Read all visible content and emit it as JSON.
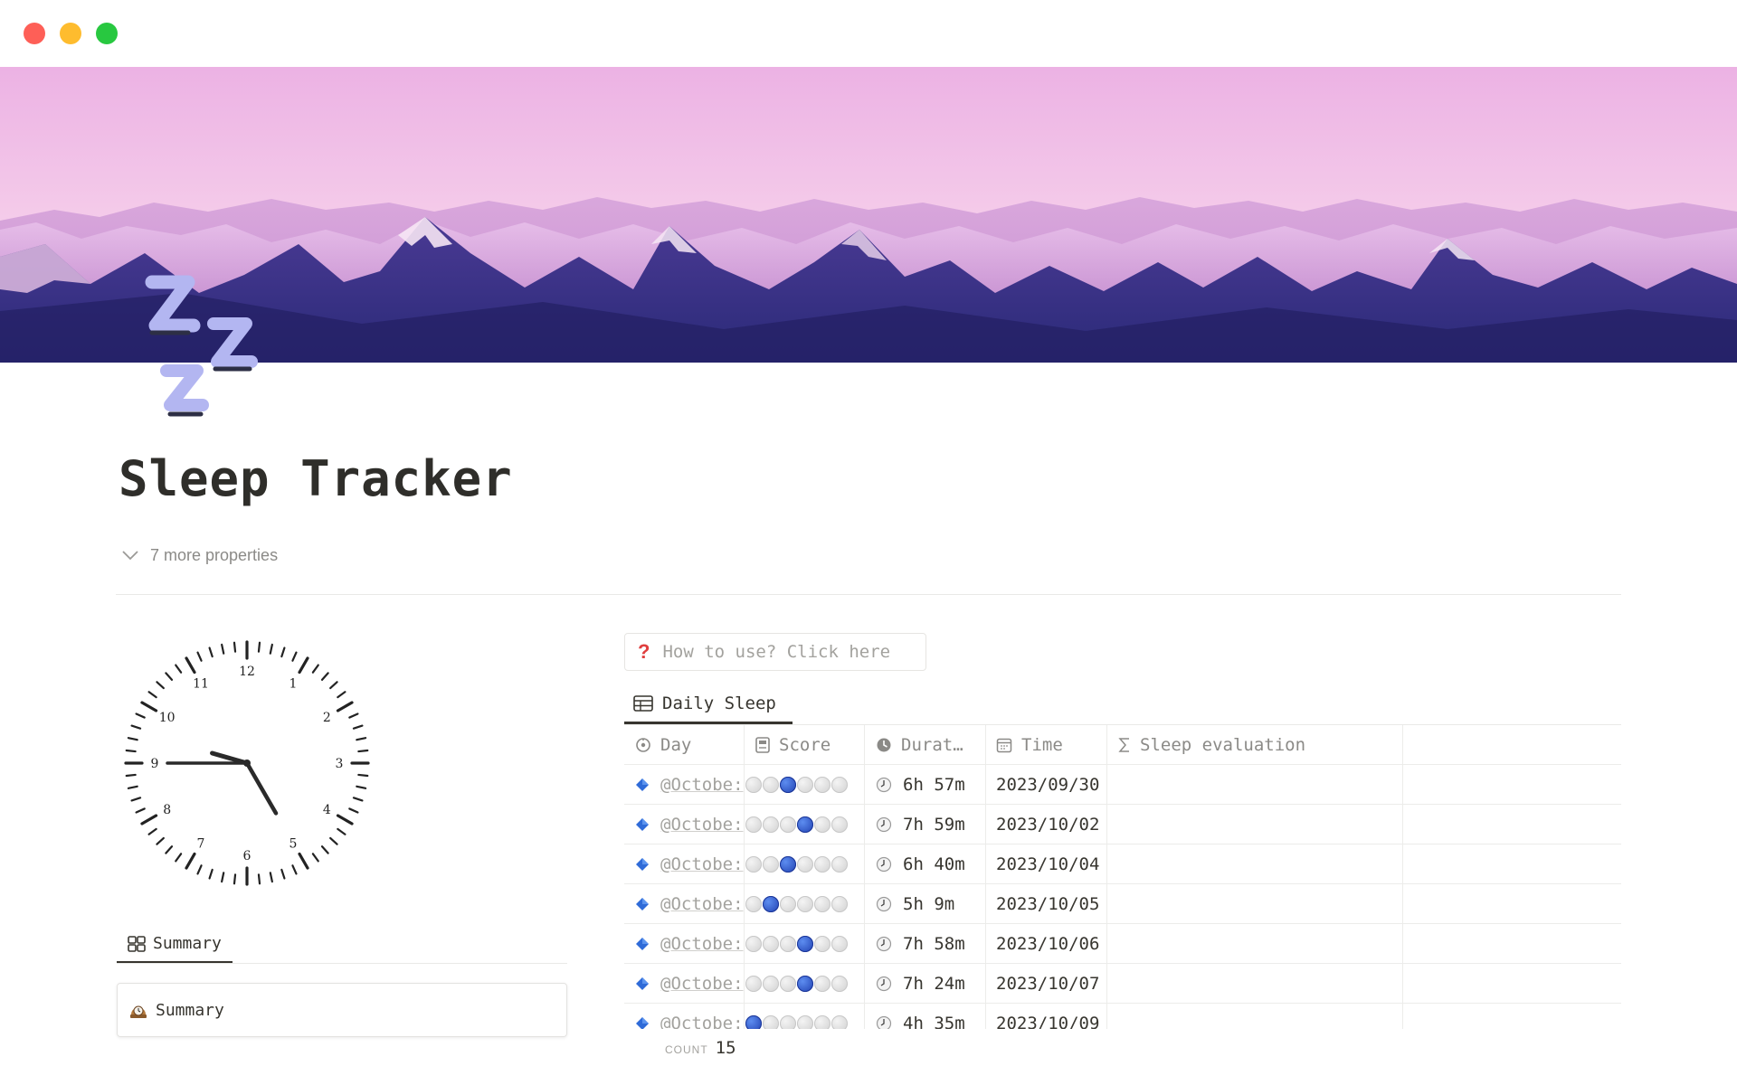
{
  "window": {
    "controls": [
      "close",
      "minimize",
      "zoom"
    ],
    "colors": {
      "close": "#fe5f57",
      "minimize": "#febc2e",
      "zoom": "#28c840"
    }
  },
  "cover": {
    "description_icon": "mountain-cover-image"
  },
  "page": {
    "icon": "zzz-icon",
    "title": "Sleep Tracker",
    "more_properties": "7 more properties"
  },
  "clock": {
    "numerals": [
      "12",
      "1",
      "2",
      "3",
      "4",
      "5",
      "6",
      "7",
      "8",
      "9",
      "10",
      "11"
    ],
    "hour_hand_angle_deg": 286,
    "minute_hand_angle_deg": 150
  },
  "summary": {
    "tab_label": "Summary",
    "card_label": "Summary"
  },
  "callout": {
    "icon": "?",
    "text": "How to use? Click here"
  },
  "database": {
    "tab_label": "Daily Sleep",
    "columns": {
      "day": "Day",
      "score": "Score",
      "duration": "Durat…",
      "time": "Time",
      "evaluation": "Sleep evaluation"
    },
    "rows": [
      {
        "day": "@Octobe:",
        "score": 3,
        "duration": "6h 57m",
        "time": "2023/09/30"
      },
      {
        "day": "@Octobe:",
        "score": 4,
        "duration": "7h 59m",
        "time": "2023/10/02"
      },
      {
        "day": "@Octobe:",
        "score": 3,
        "duration": "6h 40m",
        "time": "2023/10/04"
      },
      {
        "day": "@Octobe:",
        "score": 2,
        "duration": "5h 9m",
        "time": "2023/10/05"
      },
      {
        "day": "@Octobe:",
        "score": 4,
        "duration": "7h 58m",
        "time": "2023/10/06"
      },
      {
        "day": "@Octobe:",
        "score": 4,
        "duration": "7h 24m",
        "time": "2023/10/07"
      },
      {
        "day": "@Octobe:",
        "score": 1,
        "duration": "4h 35m",
        "time": "2023/10/09"
      }
    ],
    "score_max": 6,
    "count_label": "COUNT",
    "count_value": "15"
  },
  "colors": {
    "text": "#37352f",
    "muted": "#8b8a87",
    "score_on": "#1f3fb0",
    "diamond": "#2f6bd8",
    "callout_icon": "#e03e3e"
  }
}
